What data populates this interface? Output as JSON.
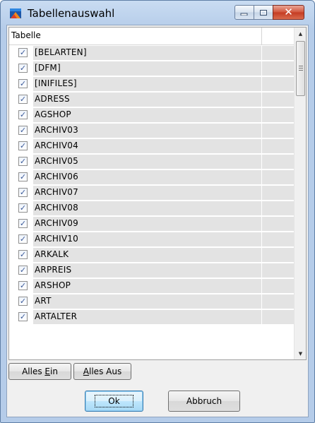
{
  "window": {
    "title": "Tabellenauswahl",
    "close_glyph": "✕"
  },
  "table": {
    "column_header": "Tabelle",
    "rows": [
      {
        "label": "[BELARTEN]",
        "checked": true
      },
      {
        "label": "[DFM]",
        "checked": true
      },
      {
        "label": "[INIFILES]",
        "checked": true
      },
      {
        "label": "ADRESS",
        "checked": true
      },
      {
        "label": "AGSHOP",
        "checked": true
      },
      {
        "label": "ARCHIV03",
        "checked": true
      },
      {
        "label": "ARCHIV04",
        "checked": true
      },
      {
        "label": "ARCHIV05",
        "checked": true
      },
      {
        "label": "ARCHIV06",
        "checked": true
      },
      {
        "label": "ARCHIV07",
        "checked": true
      },
      {
        "label": "ARCHIV08",
        "checked": true
      },
      {
        "label": "ARCHIV09",
        "checked": true
      },
      {
        "label": "ARCHIV10",
        "checked": true
      },
      {
        "label": "ARKALK",
        "checked": true
      },
      {
        "label": "ARPREIS",
        "checked": true
      },
      {
        "label": "ARSHOP",
        "checked": true
      },
      {
        "label": "ART",
        "checked": true
      },
      {
        "label": "ARTALTER",
        "checked": true
      }
    ]
  },
  "buttons": {
    "alles_ein_prefix": "Alles ",
    "alles_ein_underlined": "E",
    "alles_ein_suffix": "in",
    "alles_aus_prefix": "",
    "alles_aus_underlined": "A",
    "alles_aus_suffix": "lles Aus",
    "ok": "Ok",
    "abbruch": "Abbruch"
  },
  "icons": {
    "app": "table-selection-app-icon",
    "minimize": "minimize-icon",
    "maximize": "maximize-icon",
    "close": "close-icon",
    "check": "checkmark-icon",
    "scroll_up": "chevron-up-icon",
    "scroll_down": "chevron-down-icon"
  },
  "colors": {
    "close_button": "#c43b22",
    "checkmark": "#3b5b9a",
    "row_background": "#e3e3e3",
    "default_button_border": "#3c7fb1"
  }
}
